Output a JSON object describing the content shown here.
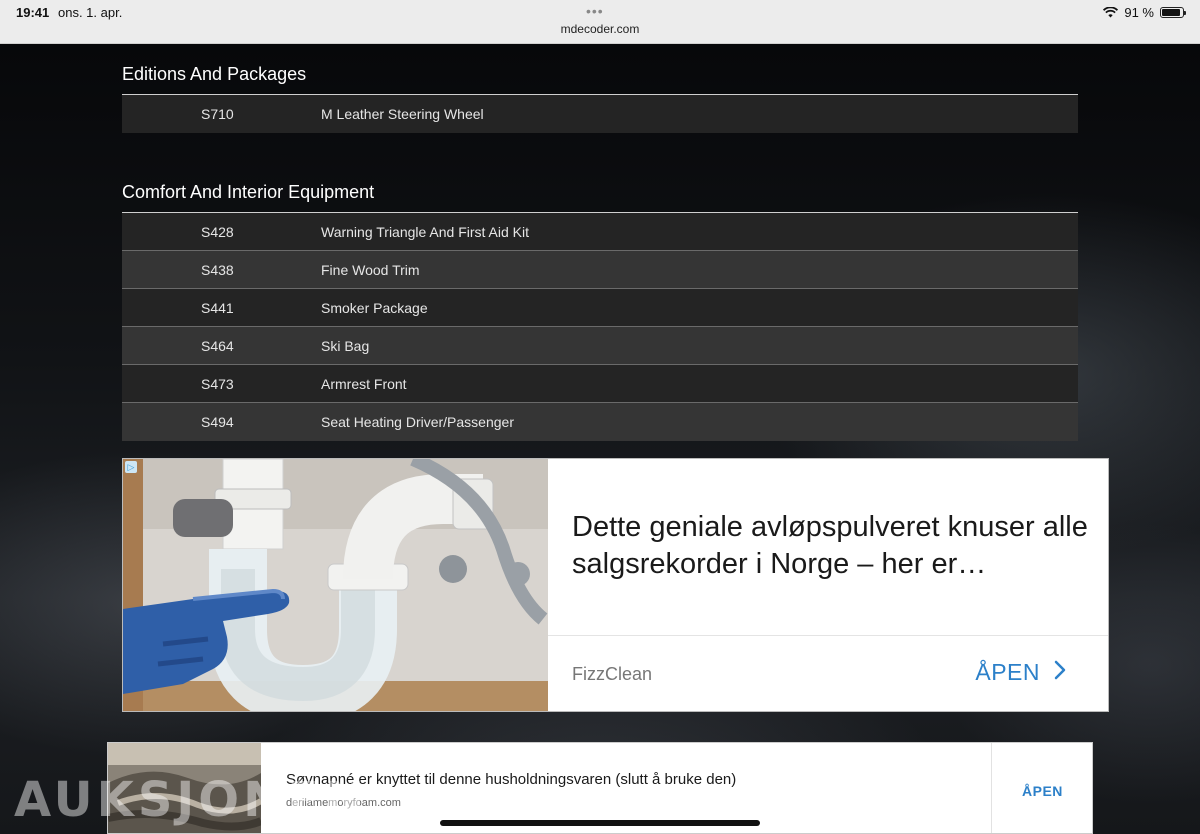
{
  "status_bar": {
    "time": "19:41",
    "date": "ons. 1. apr.",
    "dots": "•••",
    "url": "mdecoder.com",
    "battery": "91 %",
    "battery_level": 0.91
  },
  "sections": [
    {
      "title": "Editions And Packages",
      "rows": [
        {
          "code": "S710",
          "desc": "M Leather Steering Wheel"
        }
      ]
    },
    {
      "title": "Comfort And Interior Equipment",
      "rows": [
        {
          "code": "S428",
          "desc": "Warning Triangle And First Aid Kit"
        },
        {
          "code": "S438",
          "desc": "Fine Wood Trim"
        },
        {
          "code": "S441",
          "desc": "Smoker Package"
        },
        {
          "code": "S464",
          "desc": "Ski Bag"
        },
        {
          "code": "S473",
          "desc": "Armrest Front"
        },
        {
          "code": "S494",
          "desc": "Seat Heating Driver/Passenger"
        }
      ]
    }
  ],
  "ad1": {
    "headline": "Dette geniale avløpspulveret knuser alle salgsrekorder i Norge – her er…",
    "brand": "FizzClean",
    "open_label": "ÅPEN",
    "adchoice_glyph": "▷"
  },
  "ad2": {
    "headline": "Søvnapné er knyttet til denne husholdningsvaren (slutt å bruke den)",
    "domain": "derilamemoryfoam.com",
    "open_label": "ÅPEN"
  },
  "watermark": "AUKSJONEN",
  "colors": {
    "accent": "#2c80c9",
    "row_dark": "#242424",
    "row_light": "#353535"
  }
}
